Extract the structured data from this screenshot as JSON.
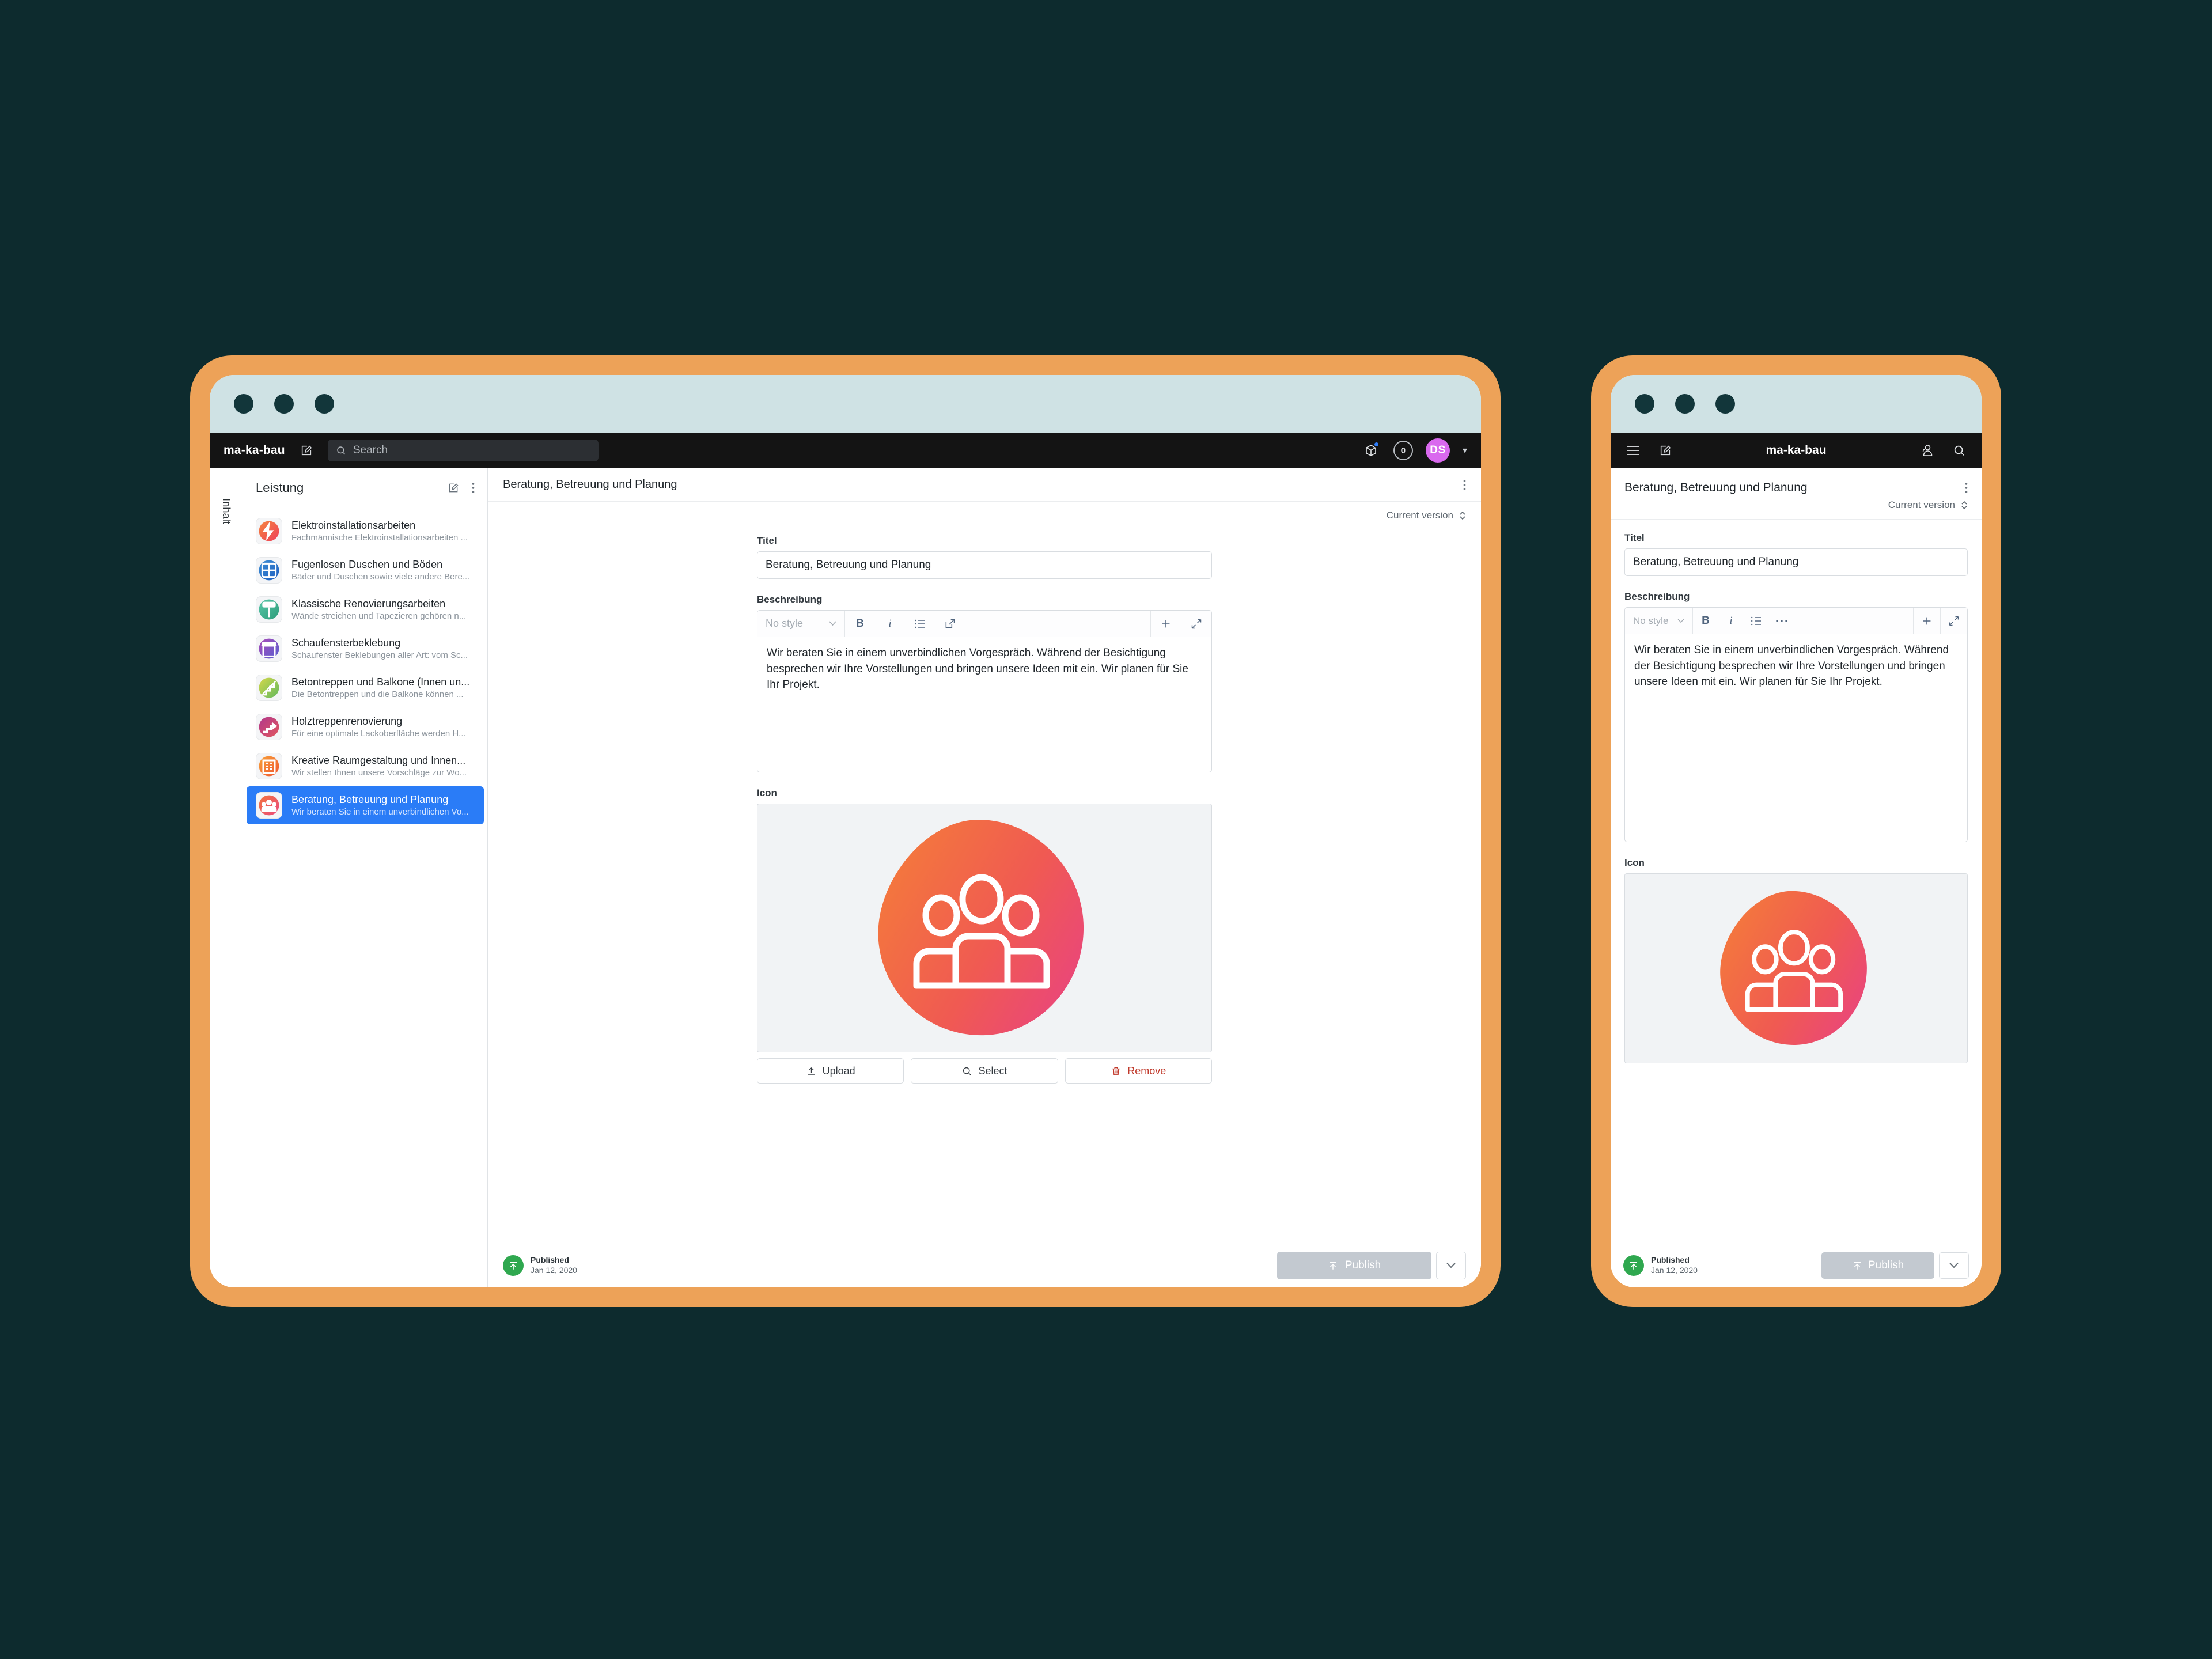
{
  "theme": {
    "page_background": "#0d2b2e",
    "device_frame": "#eda258",
    "titlebar": "#cfe2e4",
    "app_header": "#141414",
    "accent_selected": "#2a7cf7",
    "avatar_color": "#d969ee",
    "published_green": "#2fa84f",
    "publish_disabled": "#c3c9d0",
    "icon_gradient_from": "#f2743d",
    "icon_gradient_to": "#ea4a7e"
  },
  "desktop": {
    "header": {
      "brand": "ma-ka-bau",
      "compose_icon": "compose-icon",
      "search": {
        "placeholder": "Search",
        "icon": "search-icon"
      },
      "package_icon": "package-icon",
      "notifications_count": "0",
      "avatar_initials": "DS",
      "caret_icon": "chevron-down-icon"
    },
    "rail": {
      "label": "Inhalt"
    },
    "sidebar": {
      "title": "Leistung",
      "edit_icon": "compose-icon",
      "more_icon": "kebab-menu-icon",
      "items": [
        {
          "name": "Elektroinstallationsarbeiten",
          "desc": "Fachmännische Elektroinstallationsarbeiten ...",
          "icon": "bolt-icon",
          "c1": "#f5843f",
          "c2": "#ee3f5a",
          "active": false
        },
        {
          "name": "Fugenlosen Duschen und Böden",
          "desc": "Bäder und Duschen sowie viele andere Bere...",
          "icon": "tiles-icon",
          "c1": "#3f8fd4",
          "c2": "#1d5ec0",
          "active": false
        },
        {
          "name": "Klassische Renovierungsarbeiten",
          "desc": "Wände streichen und Tapezieren gehören n...",
          "icon": "roller-icon",
          "c1": "#59c7a8",
          "c2": "#2d9c7a",
          "active": false
        },
        {
          "name": "Schaufensterbeklebung",
          "desc": "Schaufenster Beklebungen aller Art: vom Sc...",
          "icon": "storefront-icon",
          "c1": "#a94bb8",
          "c2": "#5a5fd0",
          "active": false
        },
        {
          "name": "Betontreppen und Balkone (Innen un...",
          "desc": "Die Betontreppen und die Balkone können ...",
          "icon": "stairs-icon",
          "c1": "#d4d84a",
          "c2": "#63b95e",
          "active": false
        },
        {
          "name": "Holztreppenrenovierung",
          "desc": "Für eine optimale Lackoberfläche werden H...",
          "icon": "stairs-up-icon",
          "c1": "#b2388c",
          "c2": "#e0565f",
          "active": false
        },
        {
          "name": "Kreative Raumgestaltung und Innen...",
          "desc": "Wir stellen Ihnen unsere Vorschläge zur Wo...",
          "icon": "building-icon",
          "c1": "#f7a23a",
          "c2": "#f0552f",
          "active": false
        },
        {
          "name": "Beratung, Betreuung und Planung",
          "desc": "Wir beraten Sie in einem unverbindlichen Vo...",
          "icon": "people-icon",
          "c1": "#f2743d",
          "c2": "#ea4a7e",
          "active": true
        }
      ]
    },
    "editor": {
      "title": "Beratung, Betreuung und Planung",
      "more_icon": "kebab-menu-icon",
      "version_label": "Current version",
      "version_icon": "chevron-updown-icon",
      "fields": {
        "title_label": "Titel",
        "title_value": "Beratung, Betreuung und Planung",
        "description_label": "Beschreibung",
        "description_value": "Wir beraten Sie in einem unverbindlichen Vorgespräch. Während der Besichtigung besprechen wir Ihre Vorstellungen und bringen unsere Ideen mit ein. Wir planen für Sie Ihr Projekt.",
        "icon_label": "Icon"
      },
      "richtext_toolbar": {
        "style_label": "No style",
        "style_caret": "chevron-down-icon",
        "bold": "B",
        "italic": "i",
        "list_icon": "bullet-list-icon",
        "link_icon": "external-link-icon",
        "add_icon": "plus-icon",
        "expand_icon": "expand-icon"
      },
      "media_buttons": [
        {
          "label": "Upload",
          "icon": "upload-icon",
          "style": "default"
        },
        {
          "label": "Select",
          "icon": "search-icon",
          "style": "default"
        },
        {
          "label": "Remove",
          "icon": "trash-icon",
          "style": "danger"
        }
      ]
    },
    "publish_bar": {
      "status_icon": "publish-up-icon",
      "status_label": "Published",
      "status_date": "Jan 12, 2020",
      "publish_label": "Publish",
      "publish_icon": "publish-up-icon",
      "caret_icon": "chevron-down-icon"
    }
  },
  "mobile": {
    "header": {
      "menu_icon": "hamburger-menu-icon",
      "compose_icon": "compose-icon",
      "brand": "ma-ka-bau",
      "people_icon": "user-group-icon",
      "search_icon": "search-icon"
    },
    "title": "Beratung, Betreuung und Planung",
    "more_icon": "kebab-menu-icon",
    "version_label": "Current version",
    "version_icon": "chevron-updown-icon",
    "fields": {
      "title_label": "Titel",
      "title_value": "Beratung, Betreuung und Planung",
      "description_label": "Beschreibung",
      "description_value": "Wir beraten Sie in einem unverbindlichen Vorgespräch. Während der Besichtigung besprechen wir Ihre Vorstellungen und bringen unsere Ideen mit ein. Wir planen für Sie Ihr Projekt.",
      "icon_label": "Icon"
    },
    "richtext_toolbar": {
      "style_label": "No style",
      "style_caret": "chevron-down-icon",
      "bold": "B",
      "italic": "i",
      "list_icon": "bullet-list-icon",
      "more_icon": "ellipsis-icon",
      "add_icon": "plus-icon",
      "expand_icon": "expand-icon"
    },
    "publish_bar": {
      "status_icon": "publish-up-icon",
      "status_label": "Published",
      "status_date": "Jan 12, 2020",
      "publish_label": "Publish",
      "publish_icon": "publish-up-icon",
      "caret_icon": "chevron-down-icon"
    }
  }
}
